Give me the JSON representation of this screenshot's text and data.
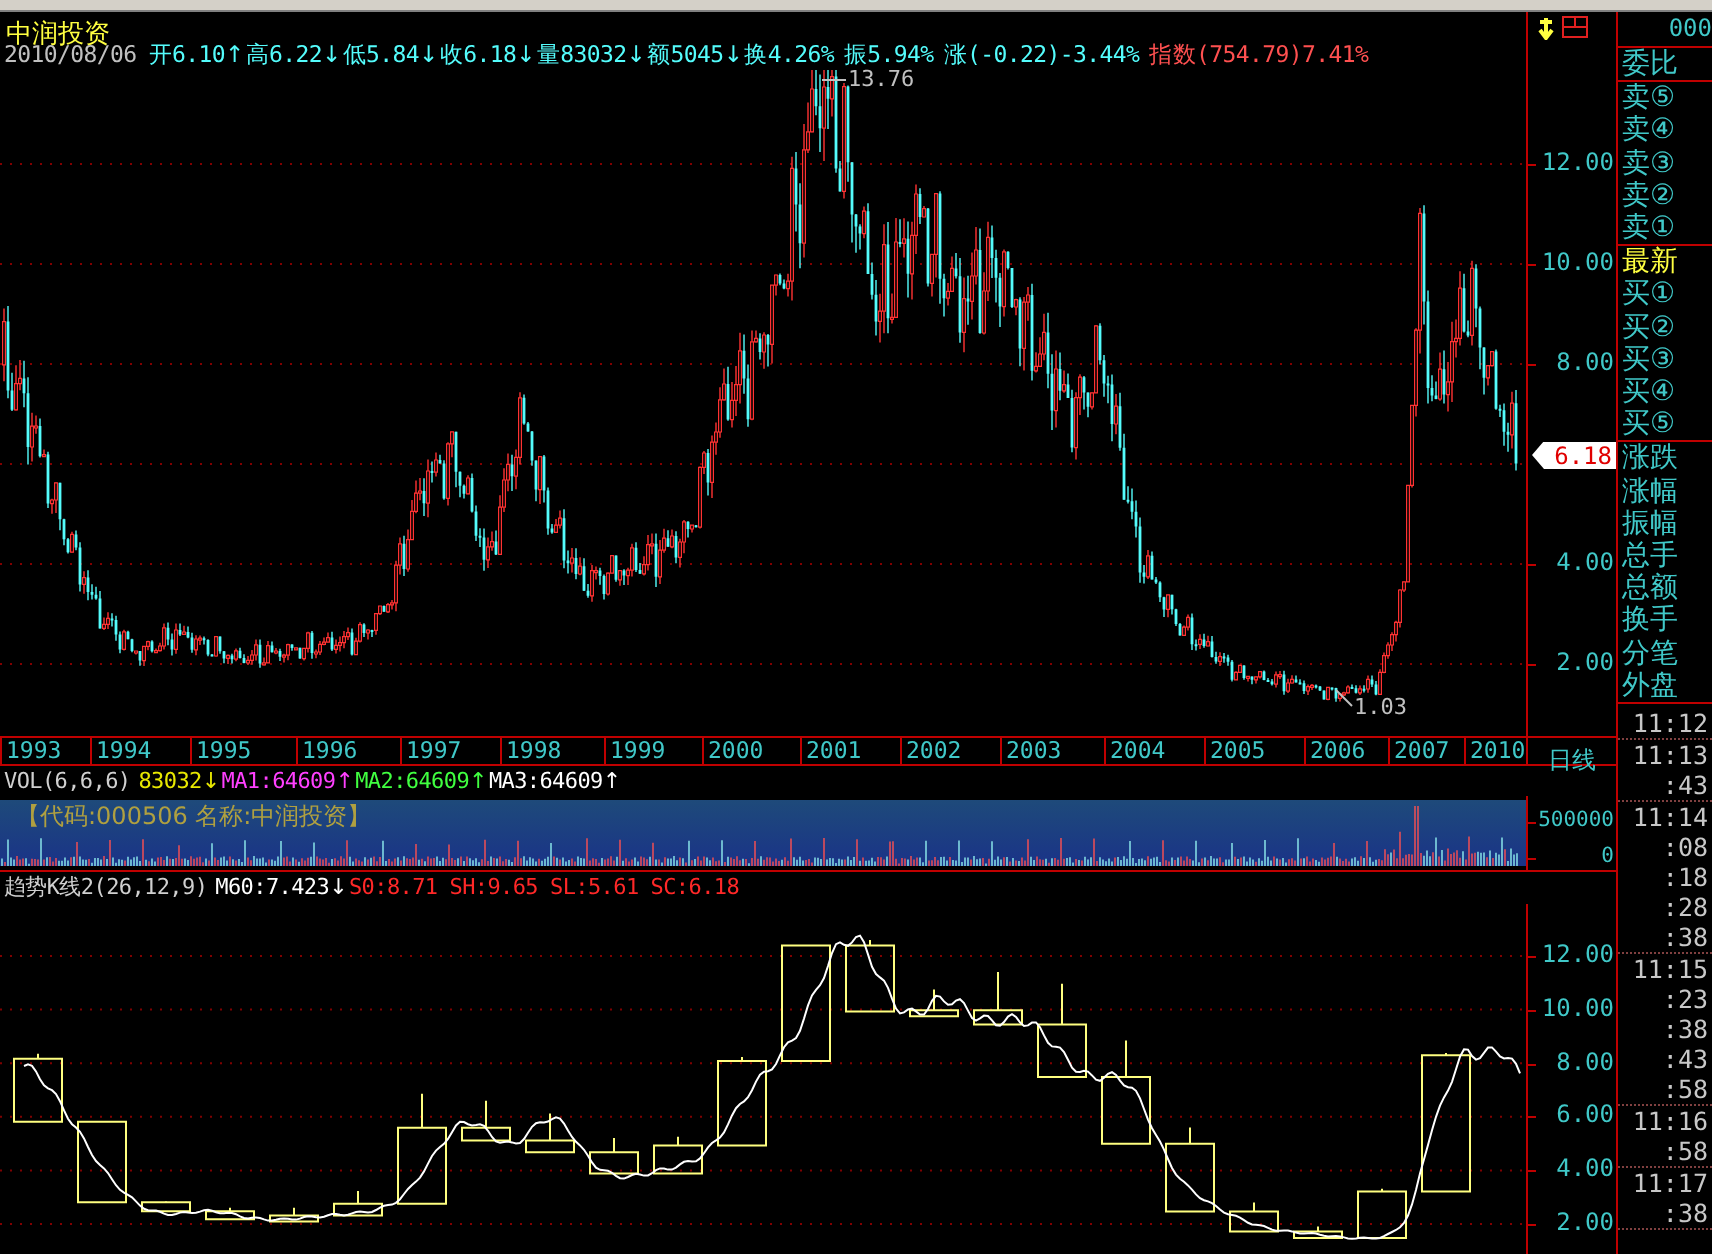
{
  "header": {
    "stock_name": "中润投资",
    "quote": [
      {
        "text": "2010/08/06",
        "kind": "date"
      },
      {
        "text": "开6.10",
        "kind": "quote",
        "arrow": "↑"
      },
      {
        "text": "高6.22",
        "kind": "quote",
        "arrow": "↓"
      },
      {
        "text": "低5.84",
        "kind": "quote",
        "arrow": "↓"
      },
      {
        "text": "收6.18",
        "kind": "quote",
        "arrow": "↓"
      },
      {
        "text": "量83032",
        "kind": "quote",
        "arrow": "↓"
      },
      {
        "text": "额5045",
        "kind": "quote",
        "arrow": "↓"
      },
      {
        "text": "换4.26%",
        "kind": "quote"
      },
      {
        "text": "振5.94%",
        "kind": "quote"
      },
      {
        "text": "涨(-0.22)-3.44%",
        "kind": "quote"
      },
      {
        "text": "指数(754.79)7.41%",
        "kind": "index"
      }
    ]
  },
  "price_chart": {
    "high_label": "13.76",
    "low_label": "1.03",
    "current_price": "6.18",
    "axis_labels": [
      "12.00",
      "10.00",
      "8.00",
      "4.00",
      "2.00"
    ],
    "years": [
      "1993",
      "1994",
      "1995",
      "1996",
      "1997",
      "1998",
      "1999",
      "2000",
      "2001",
      "2002",
      "2003",
      "2004",
      "2005",
      "2006",
      "2007",
      "2010"
    ],
    "period": "日线"
  },
  "volume": {
    "title": "VOL(6,6,6)",
    "readings": [
      {
        "text": "83032",
        "color": "#e8e800",
        "arrow": "↓"
      },
      {
        "text": "MA1:64609",
        "color": "#ff40ff",
        "arrow": "↑"
      },
      {
        "text": "MA2:64609",
        "color": "#40ff40",
        "arrow": "↑"
      },
      {
        "text": "MA3:64609",
        "color": "#ffffff",
        "arrow": "↑"
      }
    ],
    "stock_label": "【代码:000506 名称:中润投资】",
    "axis_labels": [
      "500000",
      "0"
    ]
  },
  "indicator": {
    "title": "趋势K线2(26,12,9)",
    "readings": [
      {
        "text": "M60:7.423",
        "color": "#ffffff",
        "arrow": "↓"
      },
      {
        "text": "S0:8.71",
        "color": "#ff2828"
      },
      {
        "text": "SH:9.65",
        "color": "#ff2828"
      },
      {
        "text": "SL:5.61",
        "color": "#ff2828"
      },
      {
        "text": "SC:6.18",
        "color": "#ff2828"
      }
    ],
    "axis_labels": [
      "12.00",
      "10.00",
      "8.00",
      "6.00",
      "4.00",
      "2.00"
    ]
  },
  "sidebar": {
    "code": "000",
    "sections": [
      {
        "items": [
          {
            "label": "委比",
            "kind": "field"
          }
        ]
      },
      {
        "items": [
          {
            "label": "卖⑤",
            "kind": "field"
          },
          {
            "label": "卖④",
            "kind": "field"
          },
          {
            "label": "卖③",
            "kind": "field"
          },
          {
            "label": "卖②",
            "kind": "field"
          },
          {
            "label": "卖①",
            "kind": "field"
          }
        ]
      },
      {
        "items": [
          {
            "label": "最新",
            "kind": "latest"
          },
          {
            "label": "买①",
            "kind": "field"
          },
          {
            "label": "买②",
            "kind": "field"
          },
          {
            "label": "买③",
            "kind": "field"
          },
          {
            "label": "买④",
            "kind": "field"
          },
          {
            "label": "买⑤",
            "kind": "field"
          }
        ]
      },
      {
        "items": [
          {
            "label": "涨跌",
            "kind": "field"
          },
          {
            "label": "涨幅",
            "kind": "field"
          },
          {
            "label": "振幅",
            "kind": "field"
          },
          {
            "label": "总手",
            "kind": "field"
          },
          {
            "label": "总额",
            "kind": "field"
          },
          {
            "label": "换手",
            "kind": "field"
          },
          {
            "label": "分笔",
            "kind": "field"
          },
          {
            "label": "外盘",
            "kind": "field"
          }
        ]
      }
    ],
    "ticks": [
      {
        "entries": [
          "11:12"
        ]
      },
      {
        "entries": [
          "11:13",
          ":43"
        ]
      },
      {
        "entries": [
          "11:14",
          ":08",
          ":18",
          ":28",
          ":38"
        ]
      },
      {
        "entries": [
          "11:15",
          ":23",
          ":38",
          ":43",
          ":58"
        ]
      },
      {
        "entries": [
          "11:16",
          ":58"
        ]
      },
      {
        "entries": [
          "11:17",
          ":38"
        ]
      }
    ]
  }
}
